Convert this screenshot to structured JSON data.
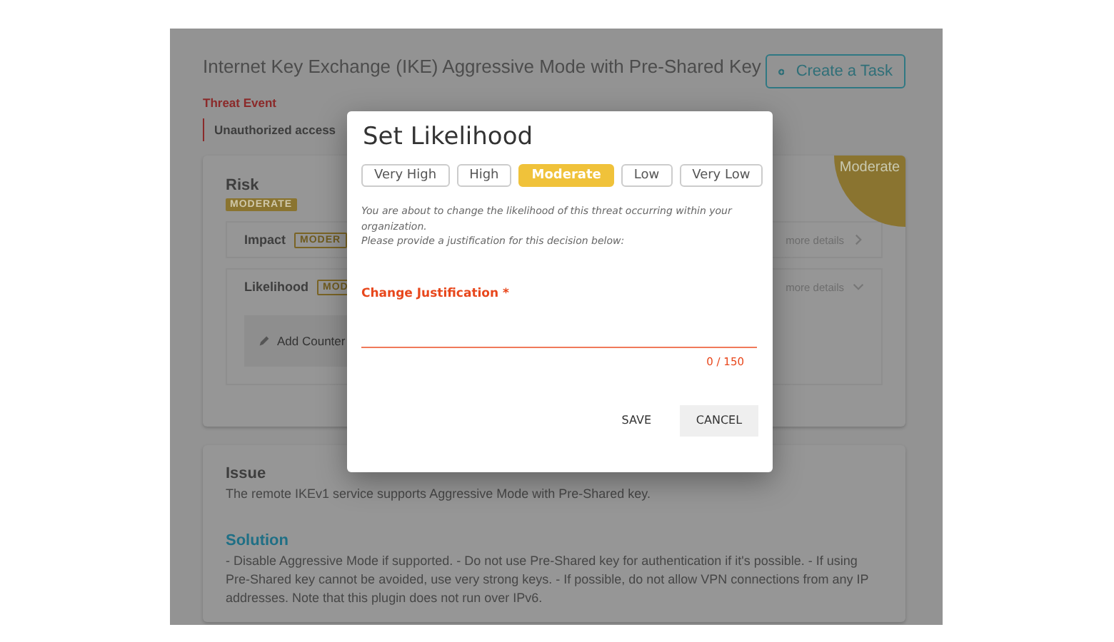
{
  "page": {
    "title": "Internet Key Exchange (IKE) Aggressive Mode with Pre-Shared Key",
    "create_task_button": "Create a Task",
    "threat_event": {
      "label": "Threat Event",
      "value": "Unauthorized access"
    },
    "risk": {
      "title": "Risk",
      "badge": "MODERATE",
      "corner_label": "Moderate",
      "rows": [
        {
          "label": "Impact",
          "badge": "MODER",
          "link": "more details",
          "expanded": false
        },
        {
          "label": "Likelihood",
          "badge": "MOD",
          "link": "more details",
          "expanded": true,
          "action": "Add Counter"
        }
      ]
    },
    "issue": {
      "title": "Issue",
      "text": "The remote IKEv1 service supports Aggressive Mode with Pre-Shared key."
    },
    "solution": {
      "title": "Solution",
      "text": "- Disable Aggressive Mode if supported. - Do not use Pre-Shared key for authentication if it's possible. - If using Pre-Shared key cannot be avoided, use very strong keys. - If possible, do not allow VPN connections from any IP addresses. Note that this plugin does not run over IPv6."
    }
  },
  "dialog": {
    "title": "Set Likelihood",
    "options": [
      {
        "label": "Very High",
        "selected": false
      },
      {
        "label": "High",
        "selected": false
      },
      {
        "label": "Moderate",
        "selected": true
      },
      {
        "label": "Low",
        "selected": false
      },
      {
        "label": "Very Low",
        "selected": false
      }
    ],
    "message": [
      "You are about to change the likelihood of this threat occurring within your organization.",
      "Please provide a justification for this decision below:"
    ],
    "field": {
      "label": "Change Justification *",
      "counter": "0 / 150"
    },
    "buttons": [
      {
        "label": "SAVE",
        "kind": "text"
      },
      {
        "label": "CANCEL",
        "kind": "filled"
      }
    ]
  }
}
